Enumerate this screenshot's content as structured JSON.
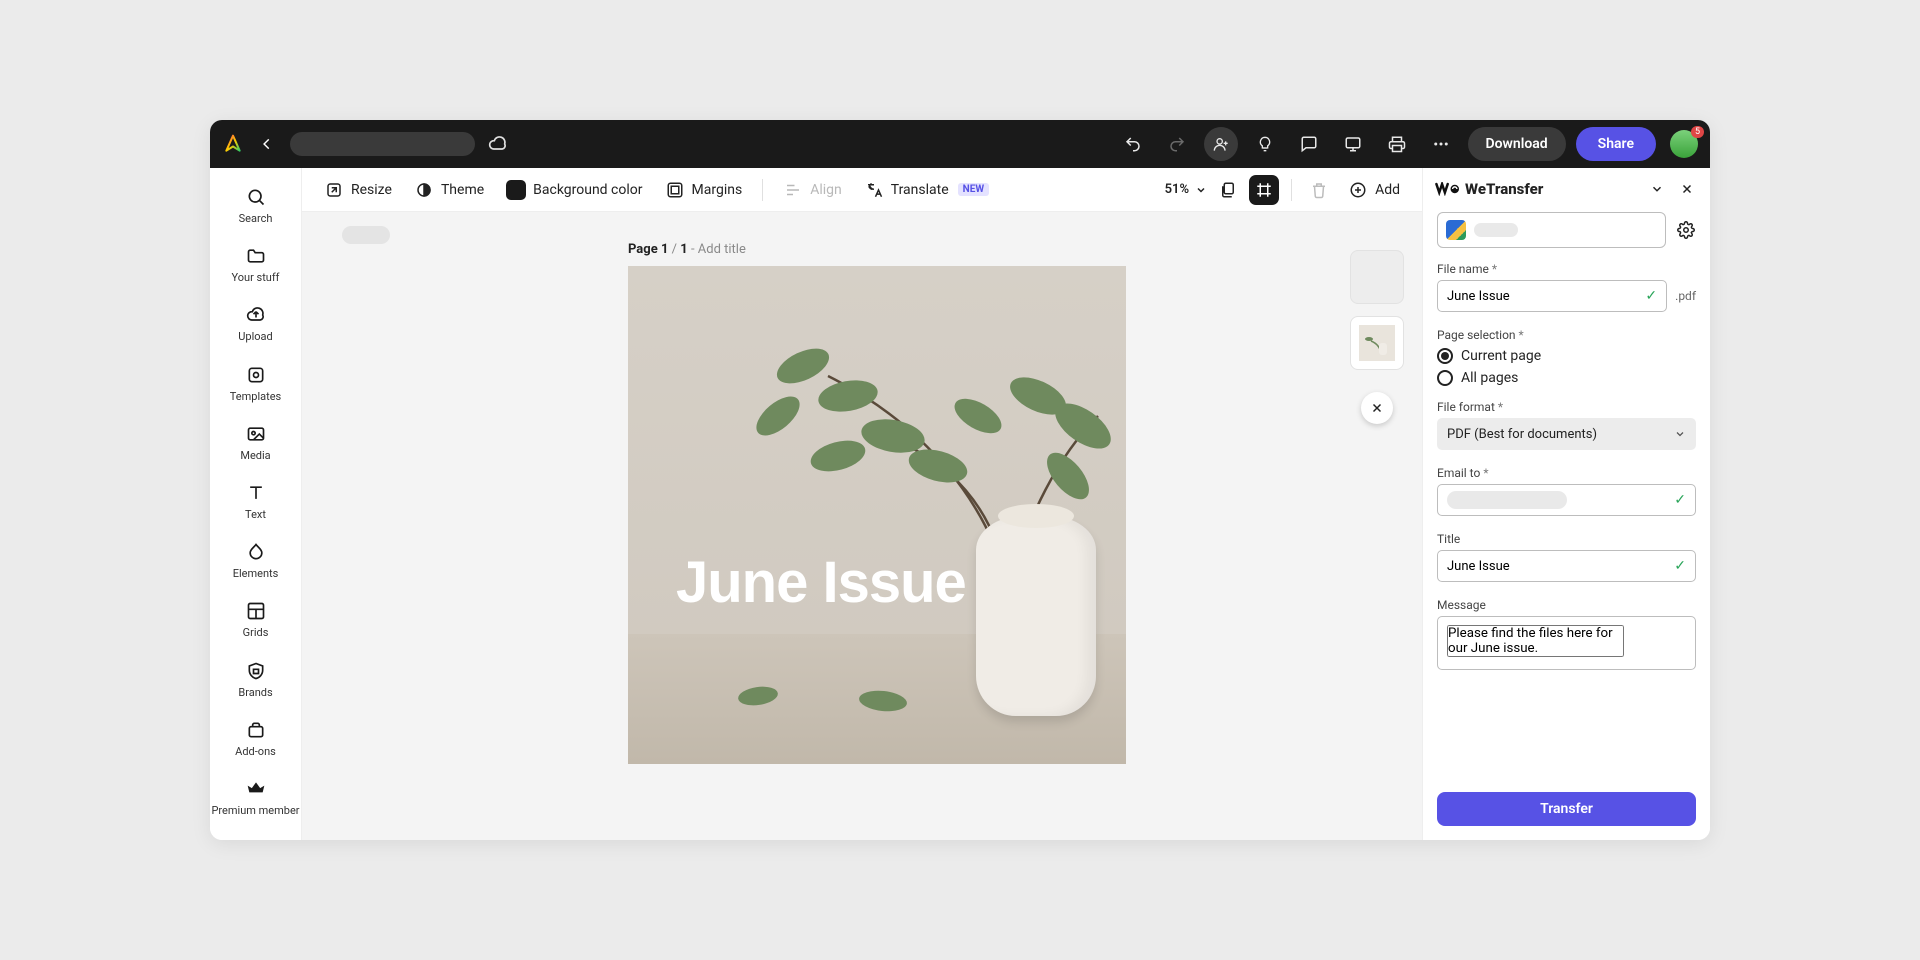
{
  "topbar": {
    "download_label": "Download",
    "share_label": "Share",
    "notification_count": "5"
  },
  "rail": {
    "items": [
      {
        "label": "Search"
      },
      {
        "label": "Your stuff"
      },
      {
        "label": "Upload"
      },
      {
        "label": "Templates"
      },
      {
        "label": "Media"
      },
      {
        "label": "Text"
      },
      {
        "label": "Elements"
      },
      {
        "label": "Grids"
      },
      {
        "label": "Brands"
      },
      {
        "label": "Add-ons"
      },
      {
        "label": "Premium member"
      }
    ]
  },
  "contextbar": {
    "resize": "Resize",
    "theme": "Theme",
    "bgcolor": "Background color",
    "margins": "Margins",
    "align": "Align",
    "translate": "Translate",
    "new_badge": "NEW",
    "zoom": "51%",
    "add": "Add"
  },
  "canvas": {
    "page_prefix": "Page ",
    "page_current": "1",
    "page_sep": " / ",
    "page_total": "1",
    "title_sep": " - ",
    "title_placeholder": "Add title",
    "artboard_title": "June Issue"
  },
  "panel": {
    "title": "WeTransfer",
    "filename_label": "File name",
    "filename_value": "June Issue",
    "filename_ext": ".pdf",
    "page_selection_label": "Page selection",
    "radio_current": "Current page",
    "radio_all": "All pages",
    "format_label": "File format",
    "format_value": "PDF (Best for documents)",
    "email_label": "Email to",
    "title_label": "Title",
    "title_value": "June Issue",
    "message_label": "Message",
    "message_value": "Please find the files here for our June issue.",
    "transfer_label": "Transfer"
  }
}
